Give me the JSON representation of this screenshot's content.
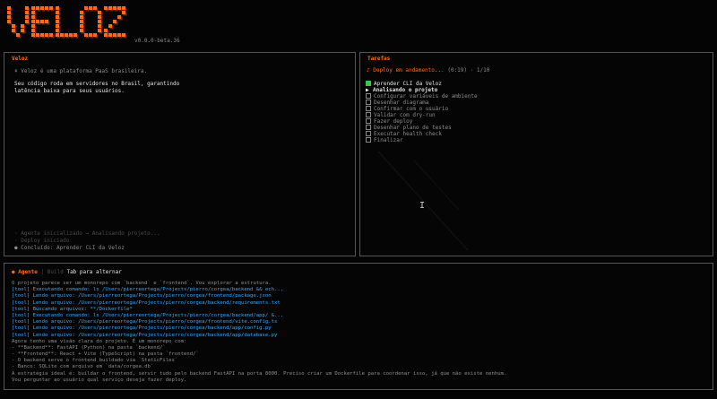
{
  "app": {
    "logo_text": "VELOZ",
    "version": "v0.0.0-beta.36"
  },
  "veloz_panel": {
    "title": "Veloz",
    "intro": "⚘ Veloz é uma plataforma PaaS brasileira.",
    "body_lines": [
      "Seu código roda em servidores no Brasil, garantindo",
      "latência baixa para seus usuários."
    ],
    "history": [
      "◦ Agente inicializado → Analisando projeto...",
      "◦ Deploy iniciado",
      "● Concluído: Aprender CLI da Veloz"
    ]
  },
  "tasks_panel": {
    "title": "Tarefas",
    "status_prefix": "♪ Deploy em andamento...",
    "status_elapsed": "(0:19)",
    "status_progress": "1/10",
    "items": [
      {
        "label": "Aprender CLI da Veloz",
        "state": "done"
      },
      {
        "label": "Analisando o projeto",
        "state": "active"
      },
      {
        "label": "Configurar variáveis de ambiente",
        "state": "pending"
      },
      {
        "label": "Desenhar diagrama",
        "state": "pending"
      },
      {
        "label": "Confirmar com o usuário",
        "state": "pending"
      },
      {
        "label": "Validar com dry-run",
        "state": "pending"
      },
      {
        "label": "Fazer deploy",
        "state": "pending"
      },
      {
        "label": "Desenhar plano de testes",
        "state": "pending"
      },
      {
        "label": "Executar health check",
        "state": "pending"
      },
      {
        "label": "Finalizar",
        "state": "pending"
      }
    ]
  },
  "agent_panel": {
    "tab_active": "● Agente",
    "tab_inactive": "| Build",
    "tab_hint": "Tab para alternar",
    "log": [
      {
        "text": "O projeto parece ser um monorepo com `backend` e `frontend`. Vou explorar a estrutura.",
        "kind": "plain"
      },
      {
        "text": "[tool] Executando comando: ls /Users/pierreortega/Projects/pierro/corgea/backend && ech...",
        "kind": "tool"
      },
      {
        "text": "[tool] Lendo arquivo: /Users/pierreortega/Projects/pierro/corgea/frontend/package.json",
        "kind": "tool"
      },
      {
        "text": "[tool] Lendo arquivo: /Users/pierreortega/Projects/pierro/corgea/backend/requirements.txt",
        "kind": "tool"
      },
      {
        "text": "[tool] Buscando arquivos: **/Dockerfile*",
        "kind": "tool"
      },
      {
        "text": "[tool] Executando comando: ls /Users/pierreortega/Projects/pierro/corgea/backend/app/ &...",
        "kind": "tool"
      },
      {
        "text": "[tool] Lendo arquivo: /Users/pierreortega/Projects/pierro/corgea/frontend/vite.config.ts",
        "kind": "tool"
      },
      {
        "text": "[tool] Lendo arquivo: /Users/pierreortega/Projects/pierro/corgea/backend/app/config.py",
        "kind": "tool"
      },
      {
        "text": "[tool] Lendo arquivo: /Users/pierreortega/Projects/pierro/corgea/backend/app/database.py",
        "kind": "tool"
      },
      {
        "text": "Agora tenho uma visão clara do projeto. É um monorepo com:",
        "kind": "plain"
      },
      {
        "text": "- **Backend**: FastAPI (Python) na pasta `backend/`",
        "kind": "plain"
      },
      {
        "text": "- **Frontend**: React + Vite (TypeScript) na pasta `frontend/`",
        "kind": "plain"
      },
      {
        "text": "- O backend serve o frontend buildado via `StaticFiles`",
        "kind": "plain"
      },
      {
        "text": "- Banco: SQLite com arquivo em `data/corgea.db`",
        "kind": "plain"
      },
      {
        "text": "A estratégia ideal é: buildar o frontend, servir tudo pelo backend FastAPI na porta 8000. Preciso criar um Dockerfile para coordenar isso, já que não existe nenhum.",
        "kind": "plain"
      },
      {
        "text": "Vou perguntar ao usuário qual serviço deseja fazer deploy.",
        "kind": "plain"
      }
    ]
  },
  "colors": {
    "accent": "#ff6a1a",
    "tool": "#36a9ff",
    "done": "#2ecc40",
    "border": "#555555"
  }
}
